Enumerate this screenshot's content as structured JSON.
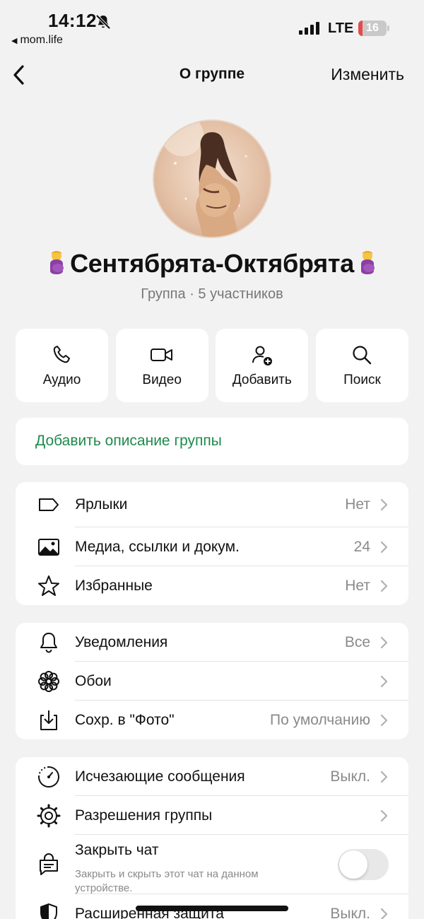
{
  "status_bar": {
    "time": "14:12",
    "back_app": "mom.life",
    "network": "LTE",
    "battery_percent": "16",
    "battery_color": "#e64a4a",
    "icons": [
      "bell-off-icon",
      "signal-icon",
      "battery-icon"
    ]
  },
  "nav": {
    "title": "О группе",
    "edit_label": "Изменить"
  },
  "group": {
    "name": "Сентябрята-Октябрята",
    "subtitle": "Группа · 5 участников"
  },
  "actions": [
    {
      "label": "Аудио",
      "icon": "phone-icon"
    },
    {
      "label": "Видео",
      "icon": "video-camera-icon"
    },
    {
      "label": "Добавить",
      "icon": "add-person-icon"
    },
    {
      "label": "Поиск",
      "icon": "search-icon"
    }
  ],
  "description": {
    "add_label": "Добавить описание группы",
    "accent_color": "#1f8a4c"
  },
  "section1": [
    {
      "label": "Ярлыки",
      "value": "Нет",
      "icon": "tag-icon"
    },
    {
      "label": "Медиа, ссылки и докум.",
      "value": "24",
      "icon": "image-icon"
    },
    {
      "label": "Избранные",
      "value": "Нет",
      "icon": "star-icon"
    }
  ],
  "section2": [
    {
      "label": "Уведомления",
      "value": "Все",
      "icon": "bell-icon"
    },
    {
      "label": "Обои",
      "value": "",
      "icon": "flower-icon"
    },
    {
      "label": "Сохр. в \"Фото\"",
      "value": "По умолчанию",
      "icon": "save-to-photos-icon"
    }
  ],
  "section3": [
    {
      "label": "Исчезающие сообщения",
      "value": "Выкл.",
      "icon": "timer-icon"
    },
    {
      "label": "Разрешения группы",
      "value": "",
      "icon": "settings-gear-icon"
    },
    {
      "label": "Закрыть чат",
      "sublabel": "Закрыть и скрыть этот чат на данном устройстве.",
      "toggle_on": false,
      "icon": "locked-chat-icon"
    },
    {
      "label": "Расширенная защита",
      "value": "Выкл.",
      "icon": "shield-icon"
    }
  ]
}
